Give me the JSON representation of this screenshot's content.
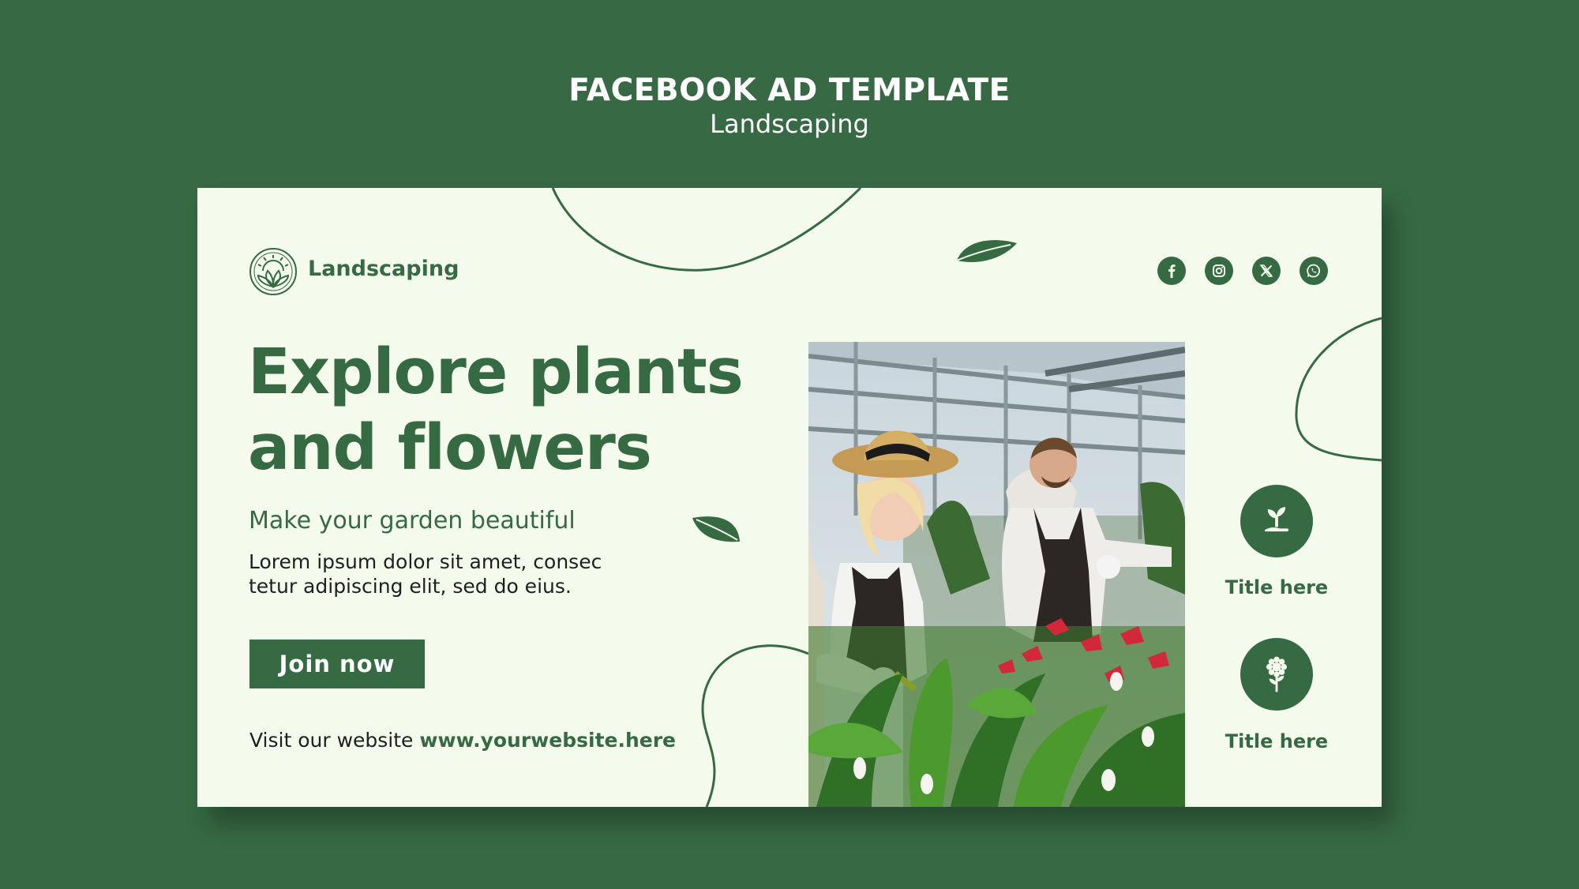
{
  "header": {
    "title": "FACEBOOK AD TEMPLATE",
    "subtitle": "Landscaping"
  },
  "brand": {
    "name": "Landscaping",
    "logo_icon": "sunrise-leaf-emblem-icon"
  },
  "social": [
    {
      "name": "facebook-icon"
    },
    {
      "name": "instagram-icon"
    },
    {
      "name": "x-icon"
    },
    {
      "name": "whatsapp-icon"
    }
  ],
  "main": {
    "headline_line1": "Explore plants",
    "headline_line2": "and flowers",
    "subheading": "Make your garden beautiful",
    "body_line1": "Lorem ipsum dolor sit amet, consec",
    "body_line2": "tetur adipiscing elit, sed do eius.",
    "cta_label": "Join now",
    "website_prefix": "Visit our website",
    "website_url": "www.yourwebsite.here"
  },
  "features": [
    {
      "label": "Title here",
      "icon": "sprout-hand-icon"
    },
    {
      "label": "Title here",
      "icon": "flower-icon"
    }
  ],
  "colors": {
    "background": "#366944",
    "card": "#f4fbec",
    "accent": "#356a43"
  }
}
